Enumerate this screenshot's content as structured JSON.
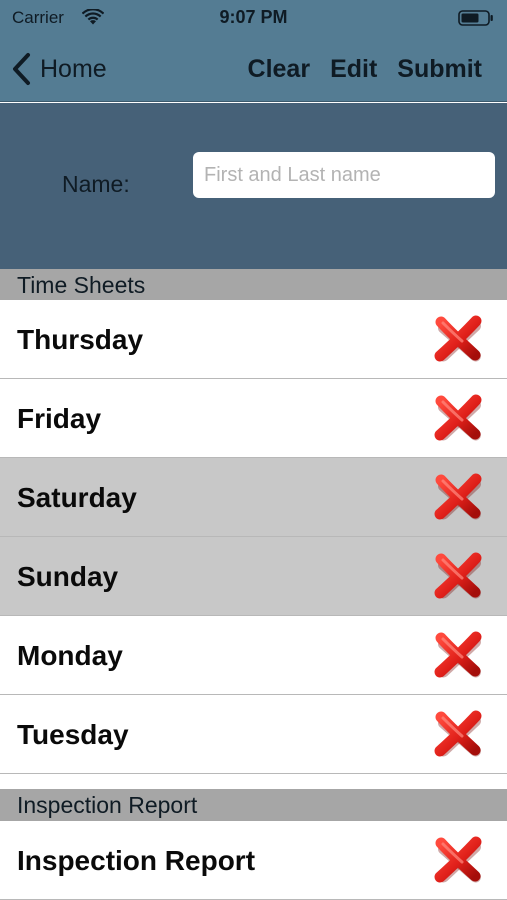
{
  "status_bar": {
    "carrier": "Carrier",
    "time": "9:07 PM",
    "icons": [
      "wifi-icon",
      "battery-icon"
    ]
  },
  "nav": {
    "back_label": "Home",
    "actions": {
      "clear": "Clear",
      "edit": "Edit",
      "submit": "Submit"
    }
  },
  "name_form": {
    "label": "Name:",
    "value": "",
    "placeholder": "First and Last name"
  },
  "sections": {
    "time_sheets": {
      "title": "Time Sheets",
      "rows": [
        {
          "label": "Thursday",
          "shaded": false,
          "icon": "close-icon"
        },
        {
          "label": "Friday",
          "shaded": false,
          "icon": "close-icon"
        },
        {
          "label": "Saturday",
          "shaded": true,
          "icon": "close-icon"
        },
        {
          "label": "Sunday",
          "shaded": true,
          "icon": "close-icon"
        },
        {
          "label": "Monday",
          "shaded": false,
          "icon": "close-icon"
        },
        {
          "label": "Tuesday",
          "shaded": false,
          "icon": "close-icon"
        }
      ]
    },
    "inspection_report": {
      "title": "Inspection Report",
      "rows": [
        {
          "label": "Inspection Report",
          "shaded": false,
          "icon": "close-icon"
        }
      ]
    }
  },
  "colors": {
    "nav_background": "#547c93",
    "header_background": "#466178",
    "section_header": "#a6a6a6",
    "shaded_row": "#c8c8c8",
    "status_icon_red": "#e0201a"
  }
}
